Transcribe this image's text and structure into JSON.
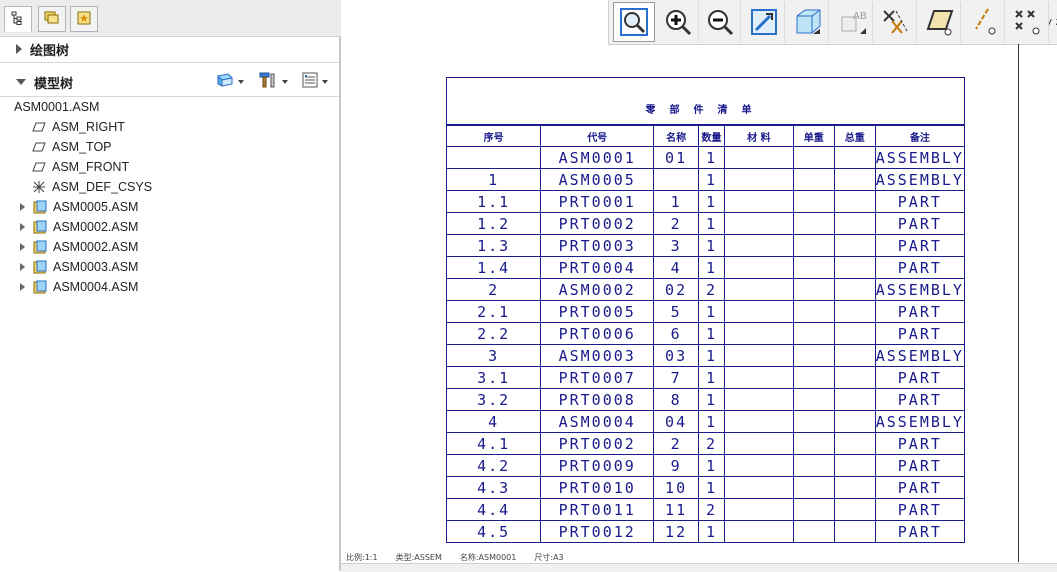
{
  "panel": {
    "sections": {
      "drawing_tree": "绘图树",
      "model_tree": "模型树"
    },
    "tree": [
      {
        "label": "ASM0001.ASM",
        "kind": "root"
      },
      {
        "label": "ASM_RIGHT",
        "kind": "datum-plane"
      },
      {
        "label": "ASM_TOP",
        "kind": "datum-plane"
      },
      {
        "label": "ASM_FRONT",
        "kind": "datum-plane"
      },
      {
        "label": "ASM_DEF_CSYS",
        "kind": "csys"
      },
      {
        "label": "ASM0005.ASM",
        "kind": "assembly"
      },
      {
        "label": "ASM0002.ASM",
        "kind": "assembly"
      },
      {
        "label": "ASM0002.ASM",
        "kind": "assembly"
      },
      {
        "label": "ASM0003.ASM",
        "kind": "assembly"
      },
      {
        "label": "ASM0004.ASM",
        "kind": "assembly"
      }
    ]
  },
  "toolbar": {
    "icons": [
      "zoom-window-icon",
      "zoom-in-icon",
      "zoom-out-icon",
      "repaint-icon",
      "shading-icon",
      "text-display-icon",
      "datum-display-icon",
      "plane-display-icon",
      "axis-display-icon",
      "point-display-icon",
      "csys-display-icon"
    ],
    "ab_label": "AB",
    "csys_letters": "y z"
  },
  "bom": {
    "title": "零部件清单",
    "headers": [
      "序号",
      "代号",
      "名称",
      "数量",
      "材  料",
      "单重",
      "总重",
      "备注"
    ],
    "rows": [
      [
        "",
        "ASM0001",
        "01",
        "1",
        "",
        "",
        "",
        "ASSEMBLY"
      ],
      [
        "1",
        "ASM0005",
        "",
        "1",
        "",
        "",
        "",
        "ASSEMBLY"
      ],
      [
        "1.1",
        "PRT0001",
        "1",
        "1",
        "",
        "",
        "",
        "PART"
      ],
      [
        "1.2",
        "PRT0002",
        "2",
        "1",
        "",
        "",
        "",
        "PART"
      ],
      [
        "1.3",
        "PRT0003",
        "3",
        "1",
        "",
        "",
        "",
        "PART"
      ],
      [
        "1.4",
        "PRT0004",
        "4",
        "1",
        "",
        "",
        "",
        "PART"
      ],
      [
        "2",
        "ASM0002",
        "02",
        "2",
        "",
        "",
        "",
        "ASSEMBLY"
      ],
      [
        "2.1",
        "PRT0005",
        "5",
        "1",
        "",
        "",
        "",
        "PART"
      ],
      [
        "2.2",
        "PRT0006",
        "6",
        "1",
        "",
        "",
        "",
        "PART"
      ],
      [
        "3",
        "ASM0003",
        "03",
        "1",
        "",
        "",
        "",
        "ASSEMBLY"
      ],
      [
        "3.1",
        "PRT0007",
        "7",
        "1",
        "",
        "",
        "",
        "PART"
      ],
      [
        "3.2",
        "PRT0008",
        "8",
        "1",
        "",
        "",
        "",
        "PART"
      ],
      [
        "4",
        "ASM0004",
        "04",
        "1",
        "",
        "",
        "",
        "ASSEMBLY"
      ],
      [
        "4.1",
        "PRT0002",
        "2",
        "2",
        "",
        "",
        "",
        "PART"
      ],
      [
        "4.2",
        "PRT0009",
        "9",
        "1",
        "",
        "",
        "",
        "PART"
      ],
      [
        "4.3",
        "PRT0010",
        "10",
        "1",
        "",
        "",
        "",
        "PART"
      ],
      [
        "4.4",
        "PRT0011",
        "11",
        "2",
        "",
        "",
        "",
        "PART"
      ],
      [
        "4.5",
        "PRT0012",
        "12",
        "1",
        "",
        "",
        "",
        "PART"
      ]
    ]
  },
  "status": {
    "scale": "比例:1:1",
    "type": "类型:ASSEM",
    "name": "名称:ASM0001",
    "size": "尺寸:A3"
  },
  "colors": {
    "drawing_ink": "#1a1a8c",
    "panel_bg": "#ececec",
    "icon_blue": "#2a6fc9"
  }
}
